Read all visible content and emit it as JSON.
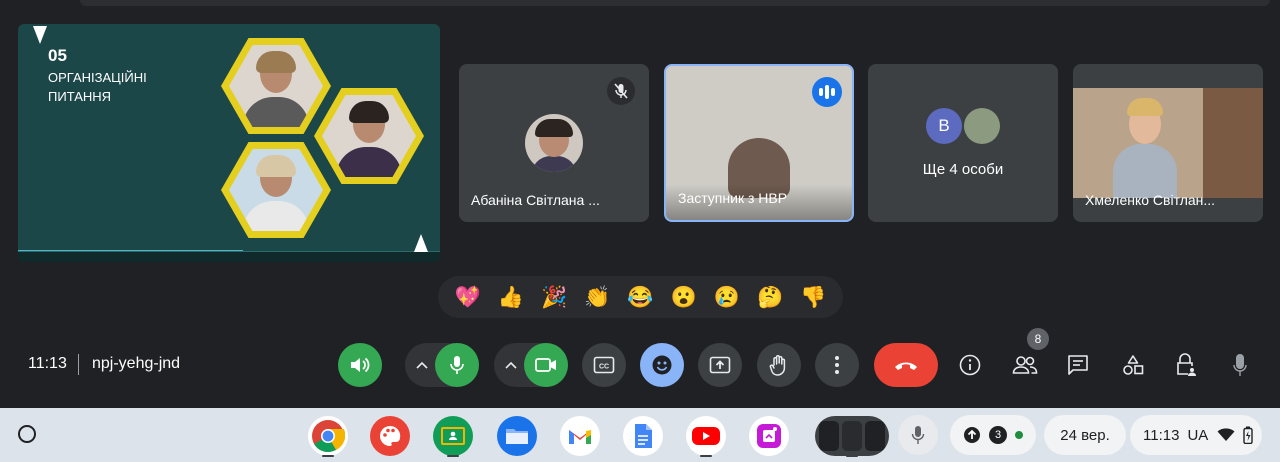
{
  "meeting": {
    "time": "11:13",
    "code": "npj-yehg-jnd",
    "people_count": "8"
  },
  "presentation": {
    "number": "05",
    "title": "ОРГАНІЗАЦІЙНІ ПИТАННЯ"
  },
  "tiles": [
    {
      "name": "Абаніна Світлана ...",
      "muted": true
    },
    {
      "name": "Заступник з НВР",
      "speaking": true
    },
    {
      "name": "Ще 4 особи",
      "avatar_letter": "В"
    },
    {
      "name": "Хмеленко Світлан..."
    }
  ],
  "reactions": [
    "💖",
    "👍",
    "🎉",
    "👏",
    "😂",
    "😮",
    "😢",
    "🤔",
    "👎"
  ],
  "controls": {
    "end_call_color": "#ea4335",
    "mic_color": "#34a853",
    "emoji_color": "#8ab4f8"
  },
  "shelf": {
    "apps": [
      "chrome-icon",
      "canvas-icon",
      "classroom-icon",
      "files-icon",
      "gmail-icon",
      "docs-icon",
      "youtube-icon",
      "photos-icon"
    ],
    "notification_count": "3",
    "date": "24 вер.",
    "clock": "11:13",
    "locale": "UA"
  }
}
